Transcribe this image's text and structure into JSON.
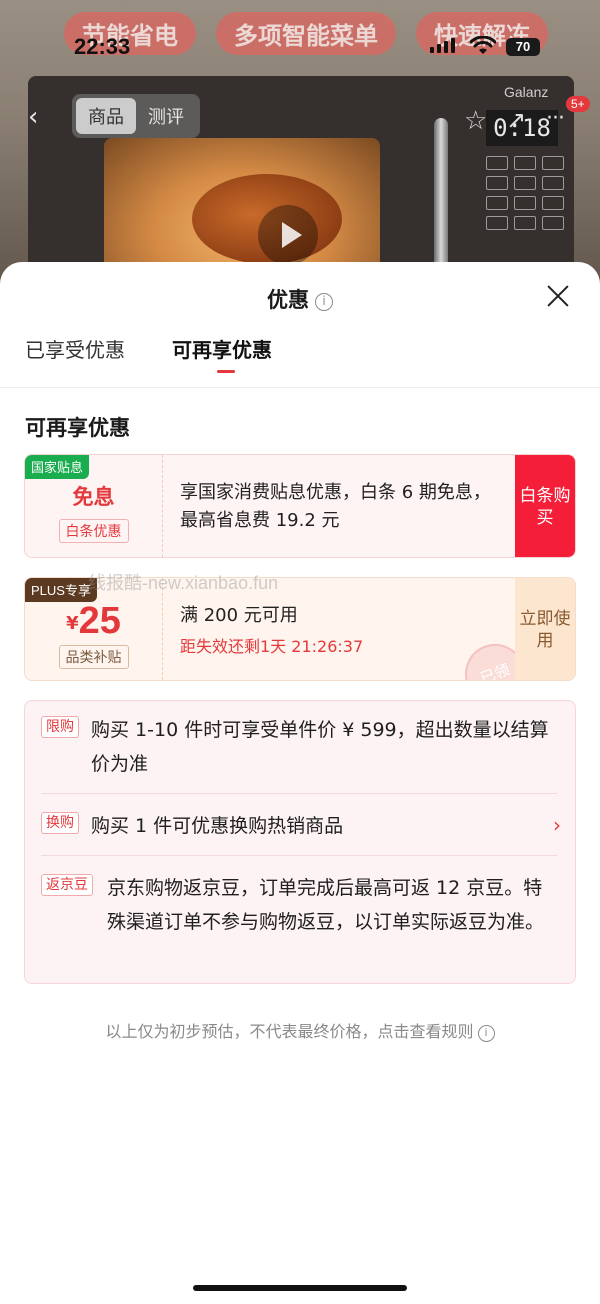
{
  "status_bar": {
    "time": "22:33",
    "battery": "70"
  },
  "background": {
    "banner_tags": [
      "节能省电",
      "多项智能菜单",
      "快速解冻"
    ],
    "segment_tabs": [
      "商品",
      "测评"
    ],
    "cart_badge": "5+",
    "brand": "Galanz",
    "display": "0:18",
    "icons": {
      "back": "back-icon",
      "star": "star-icon",
      "share": "share-icon",
      "more": "more-icon",
      "play": "play-icon"
    }
  },
  "sheet": {
    "title": "优惠",
    "tabs": [
      "已享受优惠",
      "可再享优惠"
    ],
    "active_tab": "可再享优惠",
    "section_title": "可再享优惠"
  },
  "coupons": [
    {
      "tag": "国家贴息",
      "headline": "免息",
      "sub": "白条优惠",
      "text": "享国家消费贴息优惠，白条 6 期免息，最高省息费 19.2 元",
      "action": "白条购买"
    },
    {
      "tag": "PLUS专享",
      "currency": "¥",
      "amount": "25",
      "sub": "品类补贴",
      "text": "满 200 元可用",
      "countdown": "距失效还剩1天 21:26:37",
      "action": "立即使用",
      "stamp": "已领"
    }
  ],
  "watermark": "线报酷-new.xianbao.fun",
  "promotions": [
    {
      "tag": "限购",
      "text": "购买 1-10 件时可享受单件价 ¥ 599，超出数量以结算价为准"
    },
    {
      "tag": "换购",
      "text": "购买 1 件可优惠换购热销商品"
    },
    {
      "tag": "返京豆",
      "text": "京东购物返京豆，订单完成后最高可返 12 京豆。特殊渠道订单不参与购物返豆，以订单实际返豆为准。"
    }
  ],
  "footnote": "以上仅为初步预估，不代表最终价格，点击查看规则",
  "colors": {
    "accent": "#e4393c",
    "action_red": "#f51e38",
    "green_tag": "#1aad4f",
    "plus_tag": "#5c3a22"
  }
}
